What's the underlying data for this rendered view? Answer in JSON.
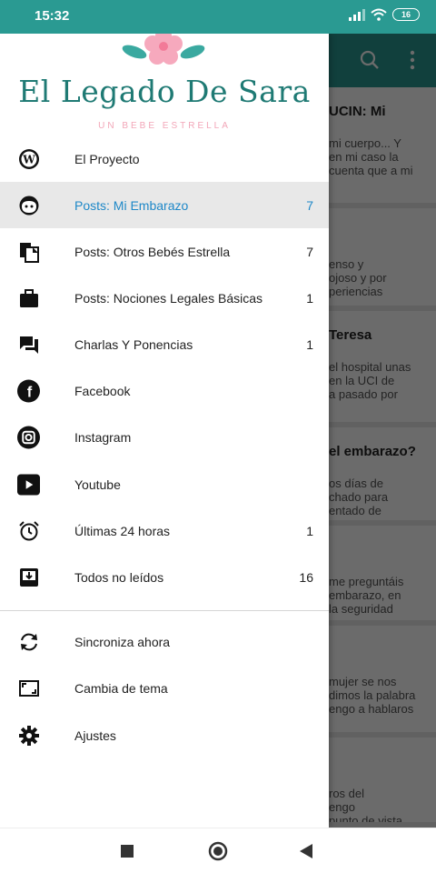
{
  "status": {
    "time": "15:32",
    "battery": "16"
  },
  "header": {
    "title": "El Legado De Sara",
    "subtitle": "UN BEBE ESTRELLA"
  },
  "colors": {
    "accent": "#2a9a92",
    "active": "#1e88c8"
  },
  "menu": [
    {
      "label": "El Proyecto",
      "count": "",
      "icon": "wordpress-icon"
    },
    {
      "label": "Posts: Mi Embarazo",
      "count": "7",
      "icon": "baby-face-icon",
      "active": true
    },
    {
      "label": "Posts: Otros Bebés Estrella",
      "count": "7",
      "icon": "documents-icon"
    },
    {
      "label": "Posts: Nociones Legales Básicas",
      "count": "1",
      "icon": "briefcase-icon"
    },
    {
      "label": "Charlas Y Ponencias",
      "count": "1",
      "icon": "chat-icon"
    },
    {
      "label": "Facebook",
      "count": "",
      "icon": "facebook-icon"
    },
    {
      "label": "Instagram",
      "count": "",
      "icon": "instagram-icon"
    },
    {
      "label": "Youtube",
      "count": "",
      "icon": "youtube-icon"
    },
    {
      "label": "Últimas 24 horas",
      "count": "1",
      "icon": "alarm-clock-icon"
    },
    {
      "label": "Todos no leídos",
      "count": "16",
      "icon": "inbox-download-icon"
    }
  ],
  "actions": [
    {
      "label": "Sincroniza ahora",
      "icon": "sync-icon"
    },
    {
      "label": "Cambia de tema",
      "icon": "theme-icon"
    },
    {
      "label": "Ajustes",
      "icon": "gear-icon"
    }
  ],
  "background_cards": [
    {
      "title": "UCIN: Mi",
      "lines": [
        "mi cuerpo... Y",
        "en mi caso la",
        "cuenta que a mi"
      ]
    },
    {
      "title": "",
      "lines": [
        "enso y",
        "ojoso y por",
        "periencias"
      ]
    },
    {
      "title": "Teresa",
      "lines": [
        "el hospital unas",
        "en la UCI de",
        "a pasado por"
      ]
    },
    {
      "title": "el embarazo?",
      "lines": [
        "os días de",
        "chado para",
        "entado de"
      ]
    },
    {
      "title": "",
      "lines": [
        "me preguntáis",
        "embarazo, en",
        "la seguridad"
      ]
    },
    {
      "title": "",
      "lines": [
        "mujer se nos",
        "dimos la palabra",
        "engo a hablaros"
      ]
    },
    {
      "title": "",
      "lines": [
        "ros del",
        "engo",
        "punto de vista"
      ]
    }
  ]
}
